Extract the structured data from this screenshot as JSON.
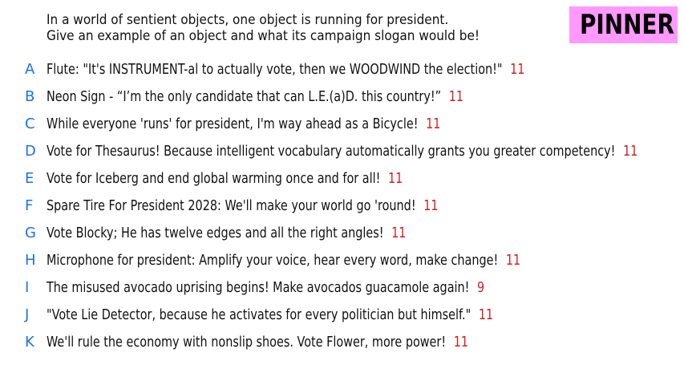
{
  "prompt": {
    "line1": "In a world of sentient objects, one object is running for president.",
    "line2": "Give an example of an object and what its campaign slogan would be!"
  },
  "badge": {
    "label": "PINNER",
    "color": "#ff99ff"
  },
  "colors": {
    "letter": "#1a73e8",
    "score": "#d61f1f",
    "text": "#111111"
  },
  "answers": [
    {
      "letter": "A",
      "text": "Flute: \"It's INSTRUMENT-al to actually vote, then we WOODWIND the election!\"",
      "score": "11"
    },
    {
      "letter": "B",
      "text": "Neon Sign - “I’m the only candidate that can L.E.(a)D. this country!”",
      "score": "11"
    },
    {
      "letter": "C",
      "text": "While everyone 'runs' for president, I'm way ahead as a Bicycle!",
      "score": "11"
    },
    {
      "letter": "D",
      "text": "Vote for Thesaurus! Because intelligent vocabulary automatically grants you greater competency!",
      "score": "11"
    },
    {
      "letter": "E",
      "text": "Vote for Iceberg and end global warming once and for all!",
      "score": "11"
    },
    {
      "letter": "F",
      "text": "Spare Tire For President 2028: We'll make your world go 'round!",
      "score": "11"
    },
    {
      "letter": "G",
      "text": "Vote Blocky; He has twelve edges and all the right angles!",
      "score": "11"
    },
    {
      "letter": "H",
      "text": "Microphone for president: Amplify your voice, hear every word, make change!",
      "score": "11"
    },
    {
      "letter": "I",
      "text": "The misused avocado uprising begins! Make avocados guacamole again!",
      "score": "9"
    },
    {
      "letter": "J",
      "text": "\"Vote Lie Detector, because he activates for every politician but himself.\"",
      "score": "11"
    },
    {
      "letter": "K",
      "text": "We'll rule the economy with nonslip shoes. Vote Flower, more power!",
      "score": "11"
    }
  ]
}
